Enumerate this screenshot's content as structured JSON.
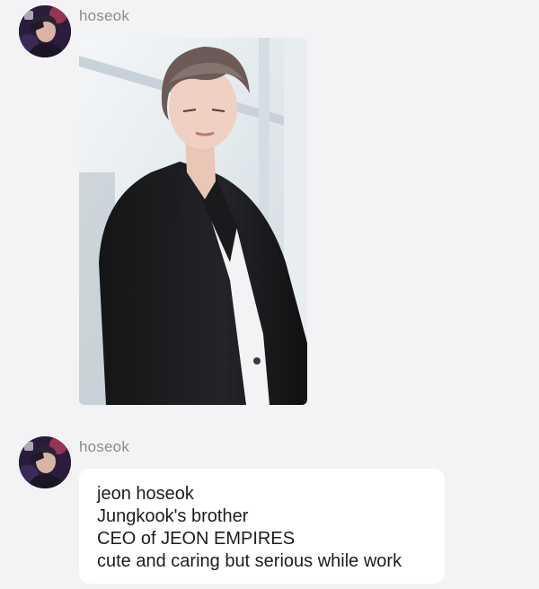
{
  "messages": [
    {
      "sender": "hoseok",
      "type": "image",
      "image": "photo-of-man-in-black-suit"
    },
    {
      "sender": "hoseok",
      "type": "text",
      "lines": [
        "jeon hoseok",
        "Jungkook's brother",
        "CEO of JEON EMPIRES",
        "cute and caring but serious while work"
      ]
    }
  ],
  "colors": {
    "background": "#f3f3f5",
    "bubble": "#ffffff",
    "sender_name": "#8c8c8c",
    "text": "#1d1d1d"
  }
}
